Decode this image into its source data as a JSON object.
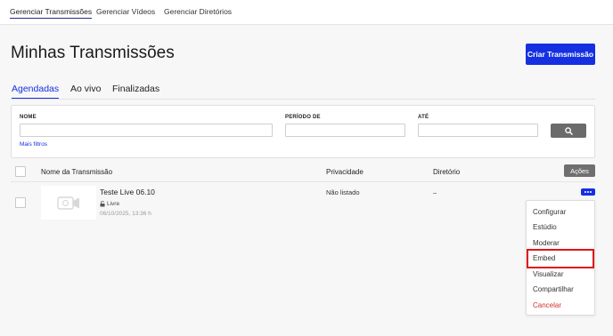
{
  "topnav": {
    "items": [
      {
        "label": "Gerenciar Transmissões",
        "active": true
      },
      {
        "label": "Gerenciar Vídeos",
        "active": false
      },
      {
        "label": "Gerenciar Diretórios",
        "active": false
      }
    ]
  },
  "page": {
    "title": "Minhas Transmissões",
    "create_button": "Criar Transmissão"
  },
  "tabs": [
    {
      "label": "Agendadas",
      "active": true
    },
    {
      "label": "Ao vivo",
      "active": false
    },
    {
      "label": "Finalizadas",
      "active": false
    }
  ],
  "filters": {
    "name_label": "NOME",
    "name_value": "",
    "period_label": "PERÍODO DE",
    "period_value": "",
    "until_label": "ATÉ",
    "until_value": "",
    "more_filters": "Mais filtros",
    "search_icon": "search-icon"
  },
  "table": {
    "columns": {
      "name": "Nome da Transmissão",
      "privacy": "Privacidade",
      "directory": "Diretório",
      "actions": "Ações"
    },
    "rows": [
      {
        "title": "Teste Live 06.10",
        "badge": "Livre",
        "date": "06/10/2025, 13:36 h",
        "privacy": "Não listado",
        "directory": "–"
      }
    ]
  },
  "menu": {
    "items": [
      {
        "label": "Configurar",
        "danger": false
      },
      {
        "label": "Estúdio",
        "danger": false
      },
      {
        "label": "Moderar",
        "danger": false
      },
      {
        "label": "Embed",
        "danger": false,
        "highlighted": true
      },
      {
        "label": "Visualizar",
        "danger": false
      },
      {
        "label": "Compartilhar",
        "danger": false
      },
      {
        "label": "Cancelar",
        "danger": true
      }
    ]
  },
  "colors": {
    "accent": "#1430e0",
    "danger": "#d32f2f",
    "highlight": "#e0141b"
  }
}
